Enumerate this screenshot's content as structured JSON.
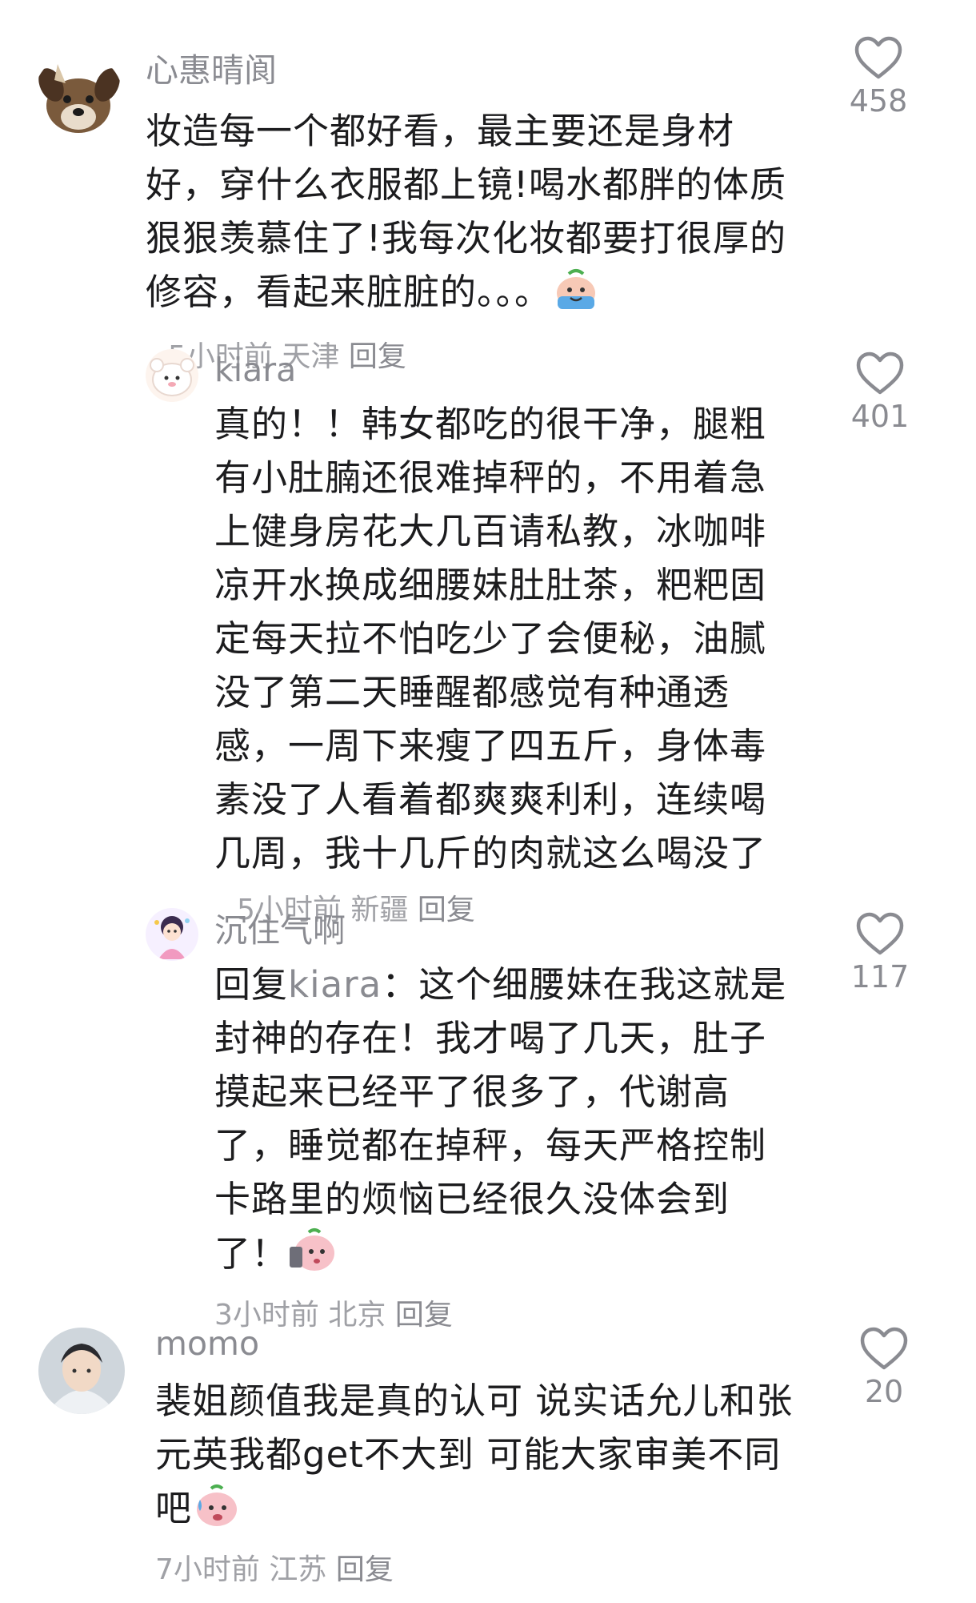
{
  "comments": [
    {
      "username": "心惠晴阆",
      "text": "妆造每一个都好看，最主要还是身材好，穿什么衣服都上镜!喝水都胖的体质狠狠羡慕住了!我每次化妆都要打很厚的修容，看起来脏脏的。。。",
      "time": "5小时前",
      "location": "天津",
      "reply_label": "回复",
      "likes": "458",
      "emoji": "crying-emoji"
    },
    {
      "username": "kiara",
      "text": "真的！！韩女都吃的很干净，腿粗有小肚腩还很难掉秤的，不用着急上健身房花大几百请私教，冰咖啡凉开水换成细腰妹肚肚茶，粑粑固定每天拉不怕吃少了会便秘，油腻没了第二天睡醒都感觉有种通透感，一周下来瘦了四五斤，身体毒素没了人看着都爽爽利利，连续喝几周，我十几斤的肉就这么喝没了",
      "time": "5小时前",
      "location": "新疆",
      "reply_label": "回复",
      "likes": "401"
    },
    {
      "username": "沉住气啊",
      "reply_prefix": "回复",
      "reply_to": "kiara",
      "reply_colon": "：",
      "text": "这个细腰妹在我这就是封神的存在！我才喝了几天，肚子摸起来已经平了很多了，代谢高了，睡觉都在掉秤，每天严格控制卡路里的烦恼已经很久没体会到了！",
      "time": "3小时前",
      "location": "北京",
      "reply_label": "回复",
      "likes": "117",
      "emoji": "phone-emoji"
    },
    {
      "username": "momo",
      "text": "裴姐颜值我是真的认可 说实话允儿和张元英我都get不大到 可能大家审美不同吧",
      "time": "7小时前",
      "location": "江苏",
      "reply_label": "回复",
      "likes": "20",
      "emoji": "sweat-emoji"
    }
  ],
  "colors": {
    "username": "#8a8b91",
    "text": "#1c1c1e",
    "meta": "#a0a1a6",
    "heart_stroke": "#8a8b91"
  }
}
